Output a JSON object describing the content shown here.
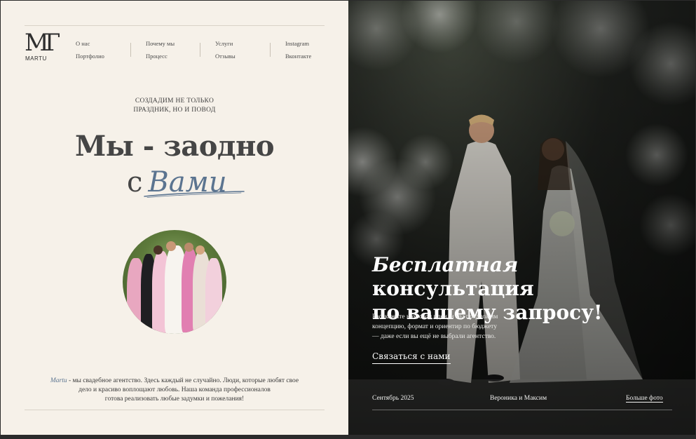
{
  "logo": {
    "monogram": "MГ",
    "wordmark": "MARTU"
  },
  "nav": {
    "col1": [
      "О нас",
      "Портфолио"
    ],
    "col2": [
      "Почему мы",
      "Процесс"
    ],
    "col3": [
      "Услуги",
      "Отзывы"
    ],
    "col4": [
      "Instagram",
      "Вконтакте"
    ]
  },
  "hero": {
    "tagline_line1": "СОЗДАДИМ НЕ ТОЛЬКО",
    "tagline_line2": "ПРАЗДНИК, НО И ПОВОД",
    "headline_line1": "Мы - заодно",
    "headline_prefix": "с",
    "headline_accent": "Вами"
  },
  "about": {
    "brand": "Martu",
    "text_line1": " - мы свадебное агентство. Здесь каждый не случайно. Люди, которые любят свое",
    "text_line2": "дело и красиво воплощают любовь. Наша команда профессионалов",
    "text_line3": "готова реализовать любые задумки и пожелания!"
  },
  "cta": {
    "title_italic": "Бесплатная",
    "title_rest": " консультация",
    "title_line2": "по вашему запросу!",
    "text_line1": "Расскажите нам свои идеи, и мы предложим",
    "text_line2": "концепцию, формат и ориентир по бюджету",
    "text_line3": "— даже если вы ещё не выбрали агентство.",
    "link_label": "Связаться с нами"
  },
  "footer_right": {
    "date": "Сентябрь 2025",
    "couple": "Вероника и Максим",
    "more_photos": "Больше фото"
  },
  "colors": {
    "left_bg": "#f6f1e9",
    "accent_blue": "#5b7490",
    "text_dark": "#454545"
  }
}
